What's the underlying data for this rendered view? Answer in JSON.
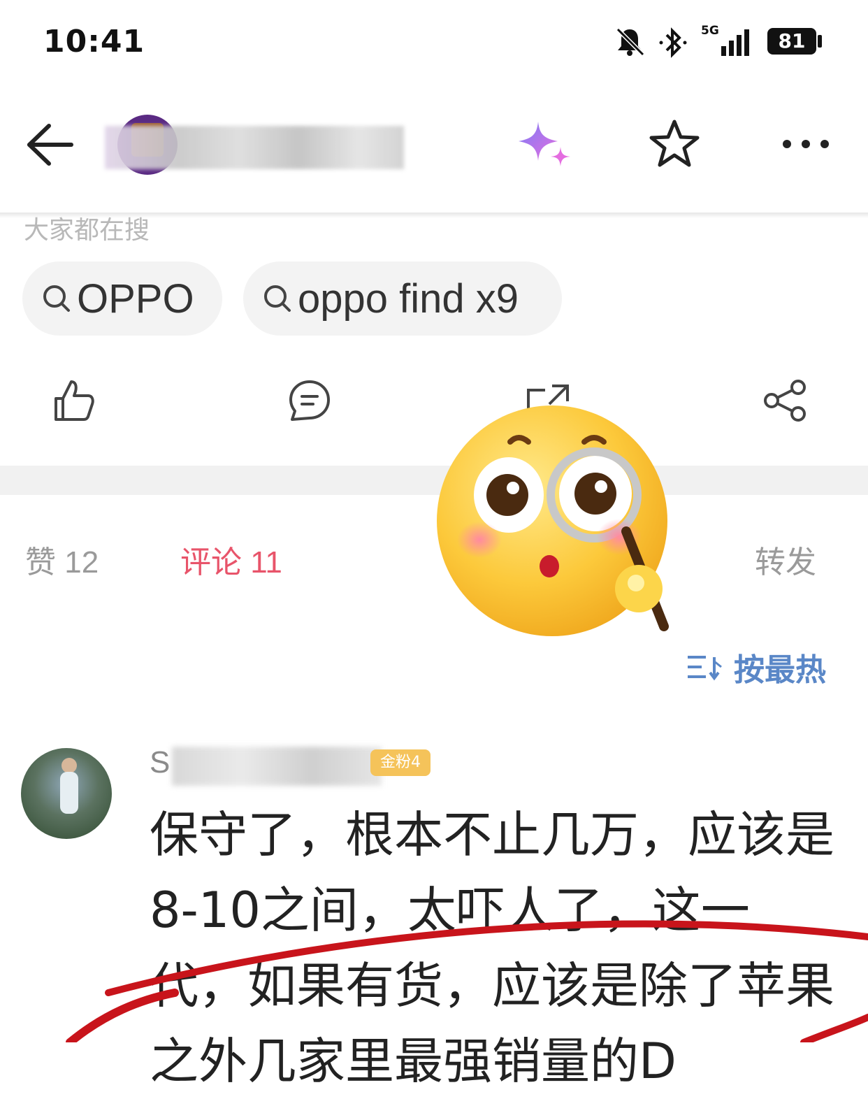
{
  "status_bar": {
    "time": "10:41",
    "network": "5G",
    "battery": "81"
  },
  "header": {
    "author_name": "",
    "icons": {
      "back": "back-arrow-icon",
      "ai": "sparkle-icon",
      "favorite": "star-icon",
      "more": "more-icon"
    }
  },
  "search_suggestions": {
    "caption": "大家都在搜",
    "chips": [
      {
        "label": "OPPO"
      },
      {
        "label": "oppo find x9"
      }
    ]
  },
  "tabs": {
    "likes": "赞 12",
    "comments": "评论 11",
    "reposts": "转发"
  },
  "sort": {
    "label": "按最热"
  },
  "comment": {
    "username_visible": "S",
    "badge": "金粉4",
    "text": "保守了，根本不止几万，应该是8-10之间，太吓人了，这一代，如果有货，应该是除了苹果之外几家里最强销量的D"
  },
  "colors": {
    "accent_pink": "#e8546a",
    "sort_blue": "#5a87c7",
    "annotation_red": "#c8141b"
  }
}
